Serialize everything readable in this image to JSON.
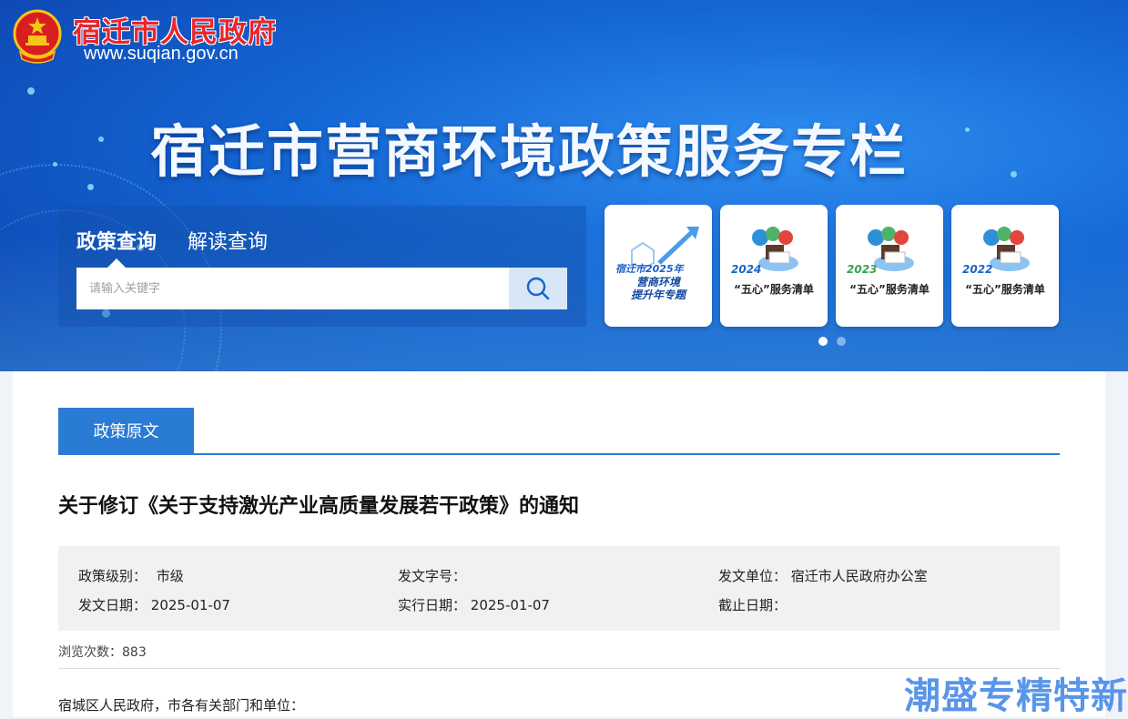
{
  "header": {
    "site_name": "宿迁市人民政府",
    "site_url": "www.suqian.gov.cn",
    "banner_title": "宿迁市营商环境政策服务专栏"
  },
  "search": {
    "tabs": [
      "政策查询",
      "解读查询"
    ],
    "placeholder": "请输入关键字",
    "icon": "search-icon"
  },
  "cards": [
    {
      "line1": "宿迁市2025年",
      "line2": "营商环境",
      "line3": "提升年专题"
    },
    {
      "year": "2024",
      "caption": "“五心”服务清单"
    },
    {
      "year": "2023",
      "caption": "“五心”服务清单"
    },
    {
      "year": "2022",
      "caption": "“五心”服务清单"
    }
  ],
  "carousel": {
    "pages": 2,
    "active": 1
  },
  "policy": {
    "tab_label": "政策原文",
    "title": "关于修订《关于支持激光产业高质量发展若干政策》的通知",
    "meta": {
      "level_label": "政策级别：",
      "level": "市级",
      "docno_label": "发文字号：",
      "docno": "",
      "issuer_label": "发文单位：",
      "issuer": "宿迁市人民政府办公室",
      "date_label": "发文日期：",
      "date": "2025-01-07",
      "effective_label": "实行日期：",
      "effective": "2025-01-07",
      "expiry_label": "截止日期：",
      "expiry": ""
    },
    "views_label": "浏览次数：",
    "views": "883",
    "greeting": "宿城区人民政府，市各有关部门和单位："
  },
  "watermark": "潮盛专精特新",
  "colors": {
    "accent": "#2a7bd3",
    "site_name": "#e8262b",
    "banner": "#1466d4"
  }
}
